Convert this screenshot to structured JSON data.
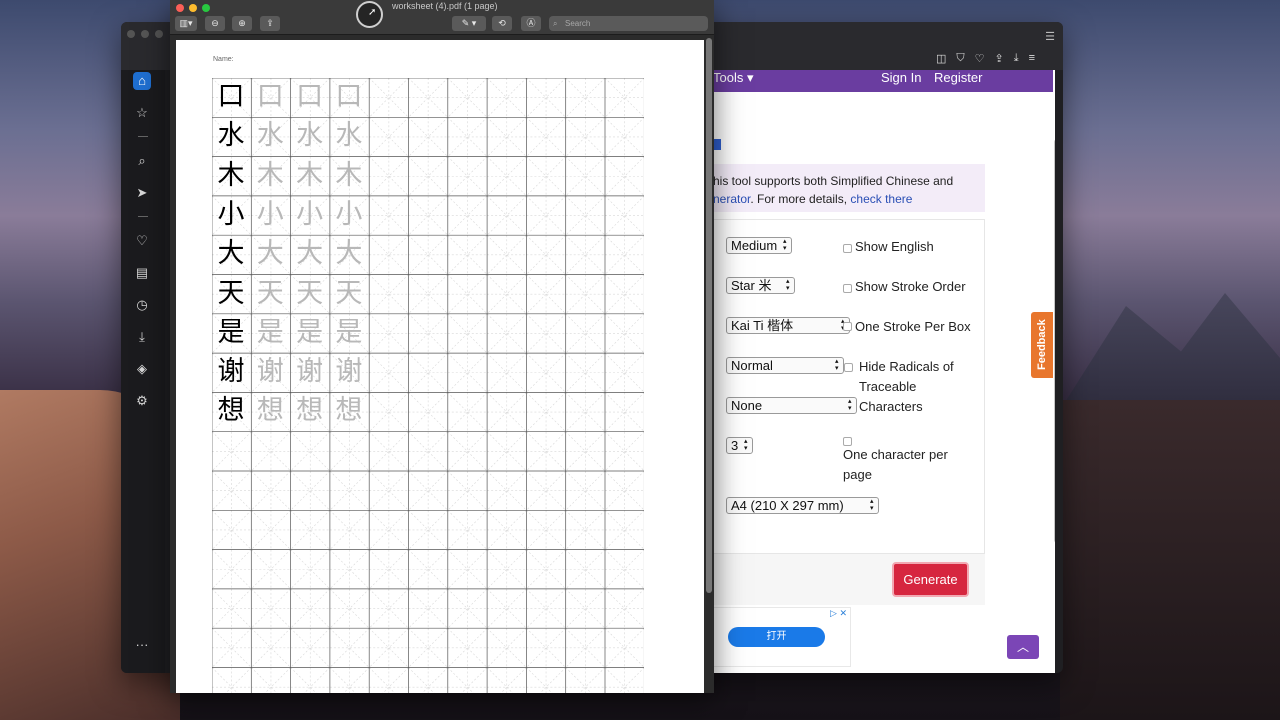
{
  "preview": {
    "title": "worksheet (4).pdf (1 page)",
    "search_placeholder": "Search",
    "name_label": "Name:",
    "characters": [
      "口",
      "水",
      "木",
      "小",
      "大",
      "天",
      "是",
      "谢",
      "想"
    ],
    "traces_per_row": 3
  },
  "navbar": {
    "tools": "Tools ▾",
    "sign_in": "Sign In",
    "register": "Register"
  },
  "note": {
    "line1": "his tool supports both Simplified Chinese and",
    "line2_link": "nerator",
    "line2_mid": ". For more details, ",
    "line2_link2": "check there"
  },
  "form": {
    "size_select": "Medium",
    "grid_select": "Star 米",
    "font_select": "Kai Ti 楷体",
    "trace_select": "Normal",
    "extra_select": "None",
    "count_select": "3",
    "paper_select": "A4 (210 X 297 mm)",
    "show_english": "Show English",
    "show_stroke_order": "Show Stroke Order",
    "one_stroke_per_box": "One Stroke Per Box",
    "hide_radicals_1": "Hide Radicals of",
    "hide_radicals_2": "Traceable",
    "hide_radicals_3": "Characters",
    "one_char_1": "One character per",
    "one_char_2": "page",
    "generate": "Generate"
  },
  "feedback": "Feedback",
  "ad": {
    "button": "打开",
    "close": "▷ ✕"
  },
  "colors": {
    "nav": "#6a3da0",
    "generate": "#d6263f",
    "feedback": "#e8762d"
  },
  "icons": [
    "home-icon",
    "star-icon",
    "search-icon",
    "send-icon",
    "heart-icon",
    "news-icon",
    "history-icon",
    "download-icon",
    "cube-icon",
    "settings-icon",
    "more-icon"
  ]
}
